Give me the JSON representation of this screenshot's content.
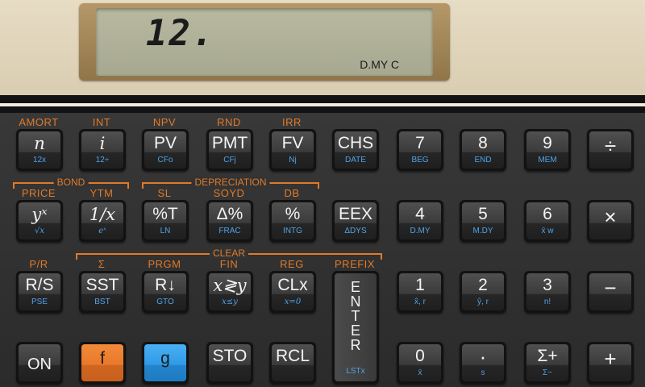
{
  "display": {
    "value": "12.",
    "status": "D.MY  C"
  },
  "rows": [
    {
      "f_labels": [
        "AMORT",
        "INT",
        "NPV",
        "RND",
        "IRR"
      ],
      "keys": [
        {
          "main": "n",
          "sub": "12x"
        },
        {
          "main": "i",
          "sub": "12÷"
        },
        {
          "main": "PV",
          "sub": "CFo"
        },
        {
          "main": "PMT",
          "sub": "CFj"
        },
        {
          "main": "FV",
          "sub": "Nj"
        },
        {
          "main": "CHS",
          "sub": "DATE"
        },
        {
          "main": "7",
          "sub": "BEG"
        },
        {
          "main": "8",
          "sub": "END"
        },
        {
          "main": "9",
          "sub": "MEM"
        },
        {
          "main": "÷",
          "sub": ""
        }
      ]
    },
    {
      "f_labels": [
        "PRICE",
        "YTM",
        "SL",
        "SOYD",
        "DB"
      ],
      "groups": [
        "BOND",
        "DEPRECIATION"
      ],
      "keys": [
        {
          "main": "yˣ",
          "sub": "√x"
        },
        {
          "main": "1/x",
          "sub": "eˣ"
        },
        {
          "main": "%T",
          "sub": "LN"
        },
        {
          "main": "Δ%",
          "sub": "FRAC"
        },
        {
          "main": "%",
          "sub": "INTG"
        },
        {
          "main": "EEX",
          "sub": "ΔDYS"
        },
        {
          "main": "4",
          "sub": "D.MY"
        },
        {
          "main": "5",
          "sub": "M.DY"
        },
        {
          "main": "6",
          "sub": "x̄ w"
        },
        {
          "main": "×",
          "sub": ""
        }
      ]
    },
    {
      "f_labels": [
        "P/R",
        "Σ",
        "PRGM",
        "FIN",
        "REG",
        "PREFIX"
      ],
      "groups": [
        "CLEAR"
      ],
      "keys": [
        {
          "main": "R/S",
          "sub": "PSE"
        },
        {
          "main": "SST",
          "sub": "BST"
        },
        {
          "main": "R↓",
          "sub": "GTO"
        },
        {
          "main": "x≷y",
          "sub": "x≤y"
        },
        {
          "main": "CLx",
          "sub": "x=0"
        },
        {
          "main": "ENTER",
          "sub": "LSTx"
        },
        {
          "main": "1",
          "sub": "x̂, r"
        },
        {
          "main": "2",
          "sub": "ŷ, r"
        },
        {
          "main": "3",
          "sub": "n!"
        },
        {
          "main": "−",
          "sub": ""
        }
      ]
    },
    {
      "keys": [
        {
          "main": "ON",
          "sub": ""
        },
        {
          "main": "f",
          "sub": ""
        },
        {
          "main": "g",
          "sub": ""
        },
        {
          "main": "STO",
          "sub": ""
        },
        {
          "main": "RCL",
          "sub": ""
        },
        {
          "main": "0",
          "sub": "x̄"
        },
        {
          "main": "·",
          "sub": "s"
        },
        {
          "main": "Σ+",
          "sub": "Σ−"
        },
        {
          "main": "+",
          "sub": ""
        }
      ]
    }
  ],
  "colors": {
    "f_label": "#e07a2a",
    "g_label": "#4fa3ea",
    "f_key": "#e9782a",
    "g_key": "#2f9ae6"
  }
}
